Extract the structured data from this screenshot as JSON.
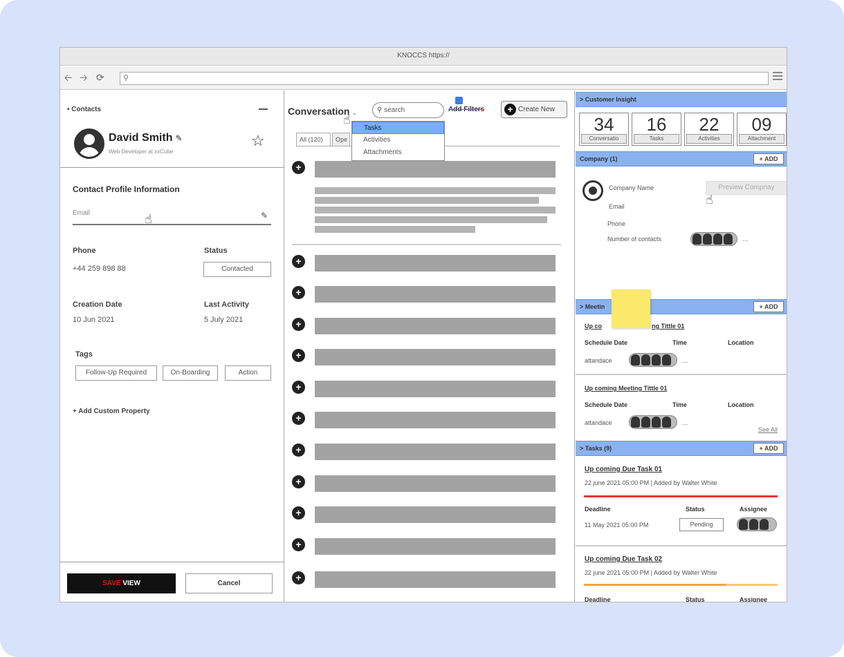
{
  "browser": {
    "title": "KNOCCS https://",
    "url_icon": "search-icon",
    "nav_icons": [
      "back-arrow-icon",
      "forward-arrow-icon",
      "reload-icon"
    ]
  },
  "left": {
    "crumb": "• Contacts",
    "name": "David Smith",
    "subtitle": "Web Developer at xxCube",
    "section_title": "Contact Profile Information",
    "email_label": "Email",
    "phone_label": "Phone",
    "phone_value": "+44 259 898 88",
    "status_label": "Status",
    "status_value": "Contacted",
    "creation_label": "Creation Date",
    "creation_value": "10 Jun 2021",
    "last_activity_label": "Last Activity",
    "last_activity_value": "5 July 2021",
    "tags_label": "Tags",
    "tags": [
      "Follow-Up Required",
      "On-Boarding",
      "Action"
    ],
    "add_custom": "+ Add Custom Property",
    "save_prefix": "SAVE",
    "save_suffix": " VIEW",
    "cancel": "Cancel"
  },
  "middle": {
    "title": "Conversation",
    "search_placeholder": "search",
    "add_filters": "Add Filters",
    "create_new": "Create New",
    "tabs": [
      "All (120)",
      "Ope"
    ],
    "dropdown": [
      "Tasks",
      "Activities",
      "Attachments"
    ],
    "row_icon": "plus-circle-icon"
  },
  "right": {
    "insight_title": "> Customer Insight",
    "stats": [
      {
        "value": "34",
        "label": "Conversatio"
      },
      {
        "value": "16",
        "label": "Tasks"
      },
      {
        "value": "22",
        "label": "Activities"
      },
      {
        "value": "09",
        "label": "Attachment"
      }
    ],
    "company_title": "Company (1)",
    "add_label": "+ ADD",
    "company_name": "Company Name",
    "preview_company": "Preview Compnay",
    "email": "Email",
    "phone": "Phone",
    "num_contacts": "Number of contacts",
    "ellipsis": "...",
    "meetings_title": "> Meetin",
    "meeting1_title": "Up coming Meeting Tittle 01",
    "meeting1_title_visible_a": "Up co",
    "meeting1_title_visible_b": "ng Tittle 01",
    "meeting2_title": "Up coming Meeting Tittle 01",
    "schedule_date": "Schedule Date",
    "time": "Time",
    "location": "Location",
    "attendace": "attandace",
    "see_all": "See All",
    "tasks_title": "> Tasks (9)",
    "task1_title": "Up coming Due Task 01",
    "task1_meta": "22 june 2021 05:00 PM | Added by Walter White",
    "task2_title": "Up coming Due Task 02",
    "task2_meta": "22 june 2021 05:00 PM | Added by Walter White",
    "deadline": "Deadline",
    "status": "Status",
    "assignee": "Assignee",
    "deadline_value": "11 May 2021 05:00 PM",
    "pending": "Pending"
  }
}
